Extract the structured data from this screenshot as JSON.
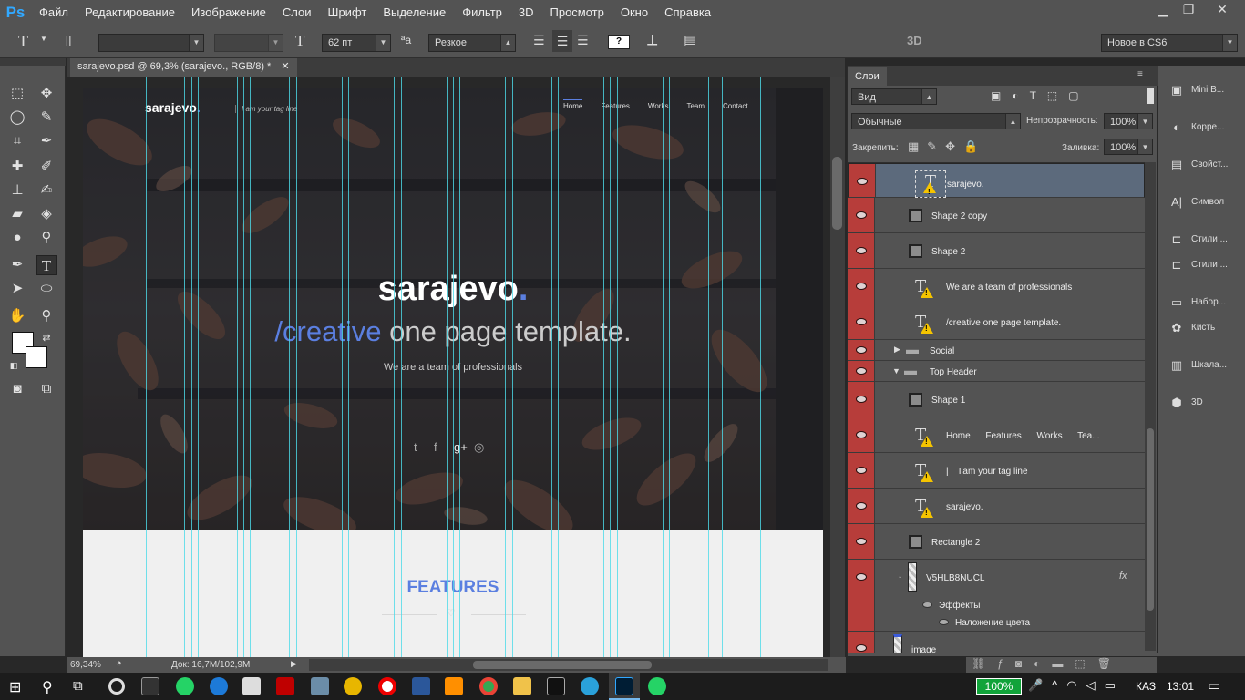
{
  "app": {
    "logo": "Ps",
    "window_controls": {
      "minimize": "▁",
      "restore": "❐",
      "close": "✕"
    }
  },
  "menu": [
    "Файл",
    "Редактирование",
    "Изображение",
    "Слои",
    "Шрифт",
    "Выделение",
    "Фильтр",
    "3D",
    "Просмотр",
    "Окно",
    "Справка"
  ],
  "options": {
    "font_size": "62 пт",
    "antialias_label": "ªa",
    "antialias": "Резкое",
    "mode_3d": "3D",
    "workspace": "Новое в CS6",
    "color_swatch": "?"
  },
  "document": {
    "tab_title": "sarajevo.psd @ 69,3% (sarajevo., RGB/8) *",
    "close": "✕"
  },
  "site": {
    "logo": "sarajevo",
    "logo_dot": ".",
    "tagline": "I am your tag line",
    "nav": [
      "Home",
      "Features",
      "Works",
      "Team",
      "Contact"
    ],
    "hero_title": "sarajevo",
    "hero_title_dot": ".",
    "hero_sub_accent": "/creative",
    "hero_sub_rest": " one page template.",
    "hero_caption": "We are a team of professionals",
    "social": [
      "t",
      "f",
      "g+",
      "◎"
    ],
    "features_title": "FEATURES",
    "accent_color": "#5b7fe0"
  },
  "layers_panel": {
    "tab": "Слои",
    "kind_filter": "Вид",
    "blend_mode": "Обычные",
    "opacity_label": "Непрозрачность:",
    "opacity": "100%",
    "lock_label": "Закрепить:",
    "fill_label": "Заливка:",
    "fill": "100%",
    "layers": [
      {
        "name": "sarajevo.",
        "kind": "text",
        "selected": true
      },
      {
        "name": "Shape 2 copy",
        "kind": "shape"
      },
      {
        "name": "Shape 2",
        "kind": "shape"
      },
      {
        "name": "We are a team of professionals",
        "kind": "text"
      },
      {
        "name": "/creative one page template.",
        "kind": "text"
      },
      {
        "name": "Social",
        "kind": "group-collapsed"
      },
      {
        "name": "Top Header",
        "kind": "group-expanded"
      },
      {
        "name": "Shape 1",
        "kind": "shape"
      },
      {
        "name": "Home      Features      Works      Tea...",
        "kind": "text"
      },
      {
        "name": "|    I'am your tag line",
        "kind": "text"
      },
      {
        "name": "sarajevo.",
        "kind": "text"
      },
      {
        "name": "Rectangle 2",
        "kind": "shape"
      },
      {
        "name": "V5HLB8NUCL",
        "kind": "image",
        "fx": "fx"
      },
      {
        "name": "Эффекты",
        "kind": "effects"
      },
      {
        "name": "Наложение цвета",
        "kind": "effect"
      },
      {
        "name": "image",
        "kind": "image"
      }
    ]
  },
  "right_dock": [
    "Mini B...",
    "Корре...",
    "Свойст...",
    "Символ",
    "Стили ...",
    "Стили ...",
    "Набор...",
    "Кисть",
    "Шкала...",
    "3D"
  ],
  "status": {
    "zoom": "69,34%",
    "doc_info": "Док: 16,7M/102,9M"
  },
  "taskbar": {
    "battery": "100%",
    "lang": "КАЗ",
    "time": "13:01"
  }
}
